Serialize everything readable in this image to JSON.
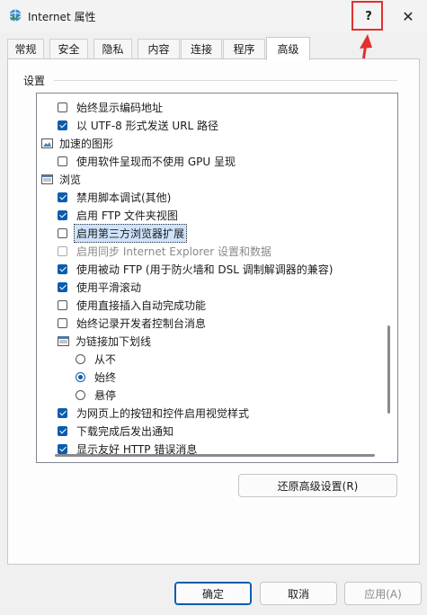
{
  "window": {
    "title": "Internet 属性",
    "help_label": "?",
    "close_label": "✕"
  },
  "tabs": [
    {
      "label": "常规"
    },
    {
      "label": "安全"
    },
    {
      "label": "隐私"
    },
    {
      "label": "内容"
    },
    {
      "label": "连接"
    },
    {
      "label": "程序"
    },
    {
      "label": "高级",
      "active": true
    }
  ],
  "settings": {
    "section_label": "设置",
    "rows": [
      {
        "type": "checkbox",
        "checked": false,
        "label": "始终显示编码地址"
      },
      {
        "type": "checkbox",
        "checked": true,
        "label": "以 UTF-8 形式发送 URL 路径"
      },
      {
        "type": "category",
        "icon": "graphics-icon",
        "label": "加速的图形"
      },
      {
        "type": "checkbox",
        "checked": false,
        "label": "使用软件呈现而不使用 GPU 呈现"
      },
      {
        "type": "category",
        "icon": "browse-icon",
        "label": "浏览"
      },
      {
        "type": "checkbox",
        "checked": true,
        "label": "禁用脚本调试(其他)"
      },
      {
        "type": "checkbox",
        "checked": true,
        "label": "启用 FTP 文件夹视图"
      },
      {
        "type": "checkbox",
        "checked": false,
        "label": "启用第三方浏览器扩展",
        "focused": true
      },
      {
        "type": "checkbox",
        "checked": false,
        "label": "启用同步 Internet Explorer 设置和数据",
        "disabled": true
      },
      {
        "type": "checkbox",
        "checked": true,
        "label": "使用被动 FTP (用于防火墙和 DSL 调制解调器的兼容)"
      },
      {
        "type": "checkbox",
        "checked": true,
        "label": "使用平滑滚动"
      },
      {
        "type": "checkbox",
        "checked": false,
        "label": "使用直接插入自动完成功能"
      },
      {
        "type": "checkbox",
        "checked": false,
        "label": "始终记录开发者控制台消息"
      },
      {
        "type": "category",
        "icon": "underline-icon",
        "label": "为链接加下划线"
      },
      {
        "type": "radio",
        "selected": false,
        "label": "从不"
      },
      {
        "type": "radio",
        "selected": true,
        "label": "始终"
      },
      {
        "type": "radio",
        "selected": false,
        "label": "悬停"
      },
      {
        "type": "checkbox",
        "checked": true,
        "label": "为网页上的按钮和控件启用视觉样式"
      },
      {
        "type": "checkbox",
        "checked": true,
        "label": "下载完成后发出通知"
      },
      {
        "type": "checkbox",
        "checked": true,
        "label": "显示友好 HTTP 错误消息"
      }
    ],
    "restore_button": "还原高级设置(R)"
  },
  "footer": {
    "ok": "确定",
    "cancel": "取消",
    "apply": "应用(A)"
  },
  "colors": {
    "accent": "#0b5cad",
    "highlight": "#e0312f"
  }
}
